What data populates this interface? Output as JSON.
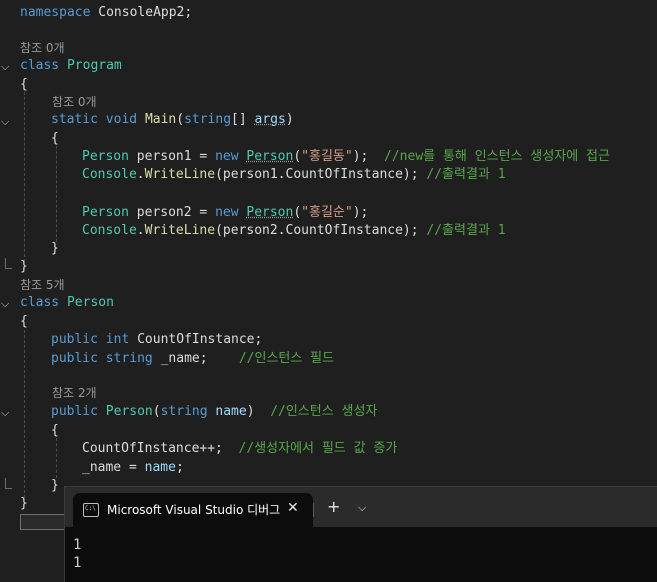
{
  "code": {
    "namespace_kw": "namespace",
    "namespace_name": "ConsoleApp2;",
    "refs_program": "참조 0개",
    "class_kw": "class",
    "program_name": "Program",
    "open_brace": "{",
    "close_brace": "}",
    "refs_main": "참조 0개",
    "static_kw": "static",
    "void_kw": "void",
    "main_name": "Main",
    "paren_open": "(",
    "string_kw": "string",
    "array_brackets": "[] ",
    "args_name": "args",
    "paren_close": ")",
    "person_type": "Person",
    "person1_decl": " person1 = ",
    "new_kw": "new",
    "space": " ",
    "str_hong1": "\"홍길동\"",
    "close_semicolon": ");",
    "comment_new": "  //new를 통해 인스턴스 생성자에 접근",
    "console_type": "Console",
    "dot": ".",
    "writeline": "WriteLine",
    "person1_arg": "(person1.CountOfInstance); ",
    "comment_output": "//출력결과 1",
    "person2_decl": " person2 = ",
    "str_hong2": "\"홍길순\"",
    "person2_arg": "(person2.CountOfInstance); ",
    "refs_person": "참조 5개",
    "person_class_name": "Person",
    "public_kw": "public",
    "int_kw": "int",
    "count_field": " CountOfInstance;",
    "name_field": " _name;    ",
    "comment_field": "//인스턴스 필드",
    "refs_ctor": "참조 2개",
    "name_param": "name",
    "ctor_close": ")  ",
    "comment_ctor": "//인스턴스 생성자",
    "count_increment": "CountOfInstance++;  ",
    "comment_increment": "//생성자에서 필드 값 증가",
    "name_assign_lhs": "_name = ",
    "name_assign_rhs": "name",
    "semicolon": ";",
    "fold_glyph": "⌵"
  },
  "console": {
    "tab_title": "Microsoft Visual Studio 디버그",
    "icon_text": "C:\\",
    "close_glyph": "✕",
    "new_tab_glyph": "+",
    "dropdown_glyph": "⌵",
    "output": [
      "1",
      "1"
    ]
  },
  "colors": {
    "background": "#1f1f1f",
    "keyword": "#569cd6",
    "type": "#4ec9b0",
    "method": "#dcdcaa",
    "parameter": "#9cdcfe",
    "string": "#d69d85",
    "comment": "#57a64a"
  }
}
